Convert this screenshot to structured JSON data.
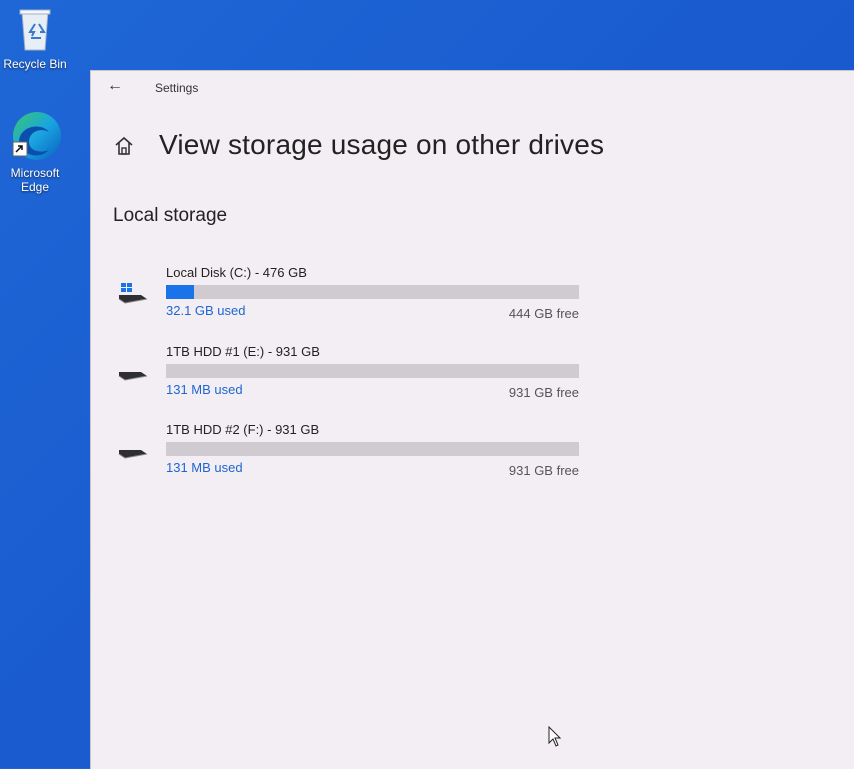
{
  "desktop": {
    "icons": [
      {
        "label": "Recycle Bin",
        "icon": "recycle-bin-icon"
      },
      {
        "label": "Microsoft\nEdge",
        "icon": "edge-icon"
      }
    ]
  },
  "window": {
    "title": "Settings",
    "back_icon": "back-arrow-icon",
    "home_icon": "home-icon",
    "page_title": "View storage usage on other drives",
    "section_title": "Local storage",
    "drives": [
      {
        "name": "Local Disk (C:) - 476 GB",
        "used": "32.1 GB used",
        "free": "444 GB free",
        "used_fraction": 0.067,
        "icon": "windows-drive-icon"
      },
      {
        "name": "1TB HDD #1 (E:) - 931 GB",
        "used": "131 MB used",
        "free": "931 GB free",
        "used_fraction": 0.0,
        "icon": "hard-drive-icon"
      },
      {
        "name": "1TB HDD #2 (F:) - 931 GB",
        "used": "131 MB used",
        "free": "931 GB free",
        "used_fraction": 0.0,
        "icon": "hard-drive-icon"
      }
    ]
  },
  "colors": {
    "accent": "#1a73e8",
    "used_text": "#1e66d0",
    "desktop": "#1a5cd0",
    "window_bg": "#f3eef3"
  }
}
